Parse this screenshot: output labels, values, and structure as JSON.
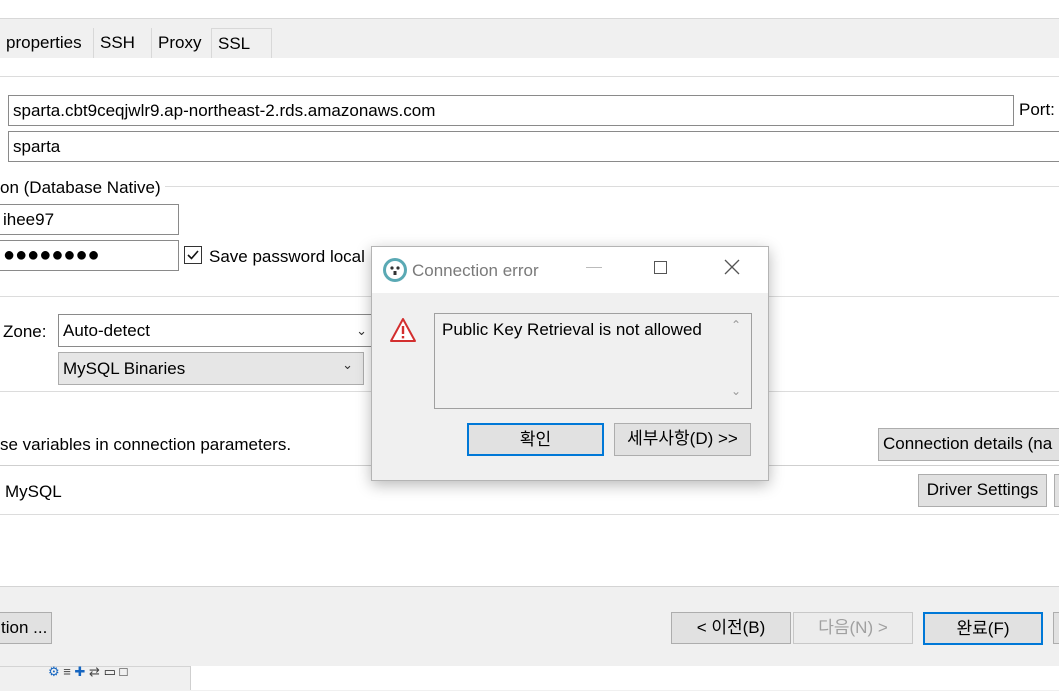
{
  "tabs": [
    {
      "label": "properties"
    },
    {
      "label": "SSH"
    },
    {
      "label": "Proxy"
    },
    {
      "label": "SSL"
    }
  ],
  "connection": {
    "host_value": "sparta.cbt9ceqjwlr9.ap-northeast-2.rds.amazonaws.com",
    "port_label": "Port:",
    "database_value": "sparta",
    "auth_section_label": "on (Database Native)",
    "username_value": "ihee97",
    "password_mask": "●●●●●●●●",
    "save_password_label": "Save password local"
  },
  "settings": {
    "timezone_label": "Zone:",
    "timezone_value": "Auto-detect",
    "local_client_value": "MySQL Binaries",
    "variables_hint": "se variables in connection parameters.",
    "connection_details_label": "Connection details (na",
    "driver_name": "MySQL",
    "driver_settings_label": "Driver Settings"
  },
  "footer": {
    "left_button_label": "tion ...",
    "back_label": "< 이전(B)",
    "next_label": "다음(N) >",
    "finish_label": "완료(F)"
  },
  "dialog": {
    "title": "Connection error",
    "message": "Public Key Retrieval is not allowed",
    "ok_label": "확인",
    "details_label": "세부사항(D) >>"
  },
  "colors": {
    "accent": "#0078d7",
    "warning": "#d32f2f"
  }
}
